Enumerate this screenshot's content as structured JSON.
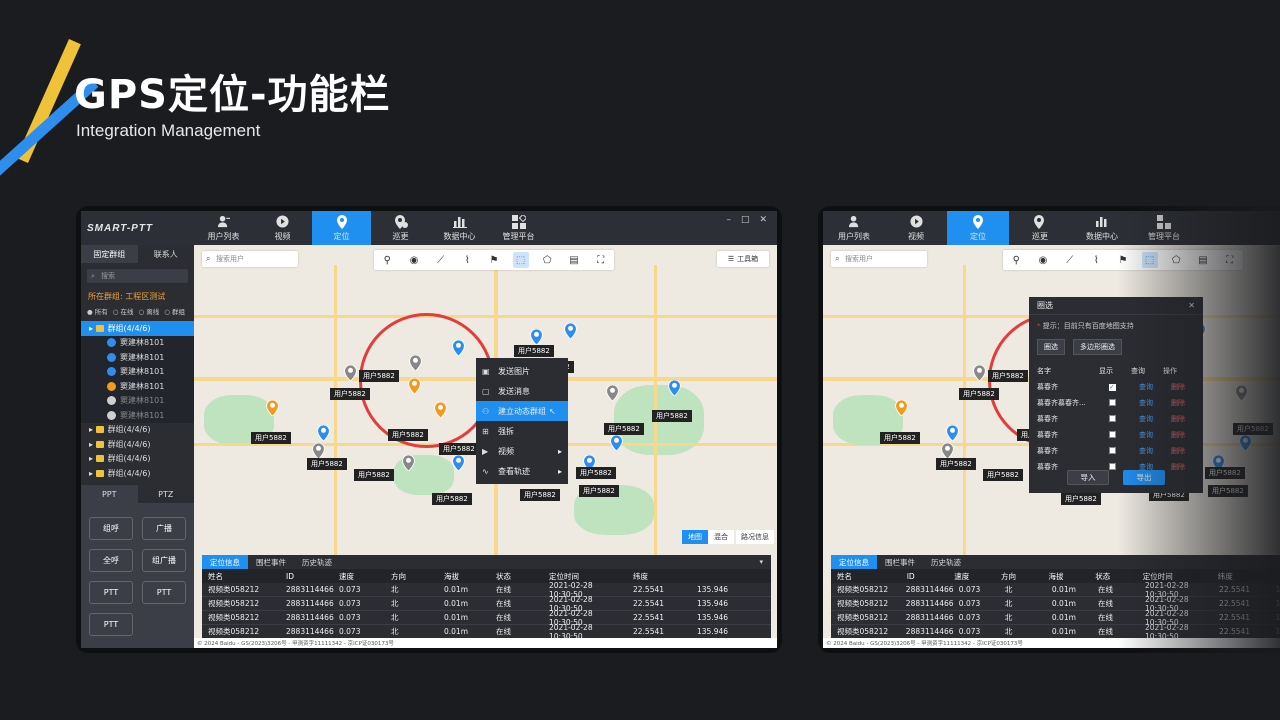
{
  "heading": {
    "title": "GPS定位-功能栏",
    "subtitle": "Integration Management"
  },
  "app": {
    "logo": "SMART-PTT",
    "win_min": "–",
    "win_max": "□",
    "win_close": "✕"
  },
  "nav": [
    {
      "label": "用户列表",
      "icon": "user-list-icon"
    },
    {
      "label": "视频",
      "icon": "play-icon"
    },
    {
      "label": "定位",
      "icon": "location-pin-icon",
      "active": true
    },
    {
      "label": "巡更",
      "icon": "patrol-icon"
    },
    {
      "label": "数据中心",
      "icon": "bar-chart-icon"
    },
    {
      "label": "管理平台",
      "icon": "grid-settings-icon"
    }
  ],
  "sidebar": {
    "tab_fixed": "固定群组",
    "tab_contacts": "联系人",
    "search_placeholder": "搜索",
    "current_group": "所在群组: 工程区测试",
    "filter_all": "所有",
    "filter_online": "在线",
    "filter_offline": "离线",
    "filter_group": "群组",
    "tree": [
      {
        "label": "群组(4/4/6)",
        "selected": true
      },
      {
        "label": "窦建林8101",
        "color": "#2d8ef0"
      },
      {
        "label": "窦建林8101",
        "color": "#2d8ef0"
      },
      {
        "label": "窦建林8101",
        "color": "#2d8ef0"
      },
      {
        "label": "窦建林8101",
        "color": "#f29a1f"
      },
      {
        "label": "窦建林8101",
        "color": "#cfcfcf",
        "offline": true
      },
      {
        "label": "窦建林8101",
        "color": "#cfcfcf",
        "offline": true
      }
    ],
    "groups": [
      "群组(4/4/6)",
      "群组(4/4/6)",
      "群组(4/4/6)",
      "群组(4/4/6)"
    ],
    "ptt_tab": "PPT",
    "ptz_tab": "PTZ",
    "buttons": [
      "组呼",
      "广播",
      "全呼",
      "组广播",
      "PTT",
      "PTT",
      "PTT"
    ]
  },
  "map": {
    "search_placeholder": "搜索用户",
    "toolbox": "工具箱",
    "marker_label": "用户5882",
    "map_btn": "地图",
    "hybrid_btn": "混合",
    "traffic_btn": "路况信息",
    "context_menu": [
      {
        "label": "发送图片"
      },
      {
        "label": "发送消息"
      },
      {
        "label": "建立动态群组",
        "highlight": true
      },
      {
        "label": "强拆"
      },
      {
        "label": "视频",
        "submenu": true
      },
      {
        "label": "查看轨迹",
        "submenu": true
      }
    ]
  },
  "panel": {
    "tabs": [
      "定位信息",
      "围栏事件",
      "历史轨迹"
    ],
    "columns": [
      "姓名",
      "ID",
      "速度",
      "方向",
      "海拔",
      "状态",
      "定位时间",
      "纬度",
      ""
    ],
    "rows": [
      [
        "视频类058212",
        "2883114466",
        "0.073",
        "北",
        "0.01m",
        "在线",
        "2021-02-28 10:30:50",
        "22.5541",
        "135.946"
      ],
      [
        "视频类058212",
        "2883114466",
        "0.073",
        "北",
        "0.01m",
        "在线",
        "2021-02-28 10:30:50",
        "22.5541",
        "135.946"
      ],
      [
        "视频类058212",
        "2883114466",
        "0.073",
        "北",
        "0.01m",
        "在线",
        "2021-02-28 10:30:50",
        "22.5541",
        "135.946"
      ],
      [
        "视频类058212",
        "2883114466",
        "0.073",
        "北",
        "0.01m",
        "在线",
        "2021-02-28 10:30:50",
        "22.5541",
        "135.946"
      ]
    ]
  },
  "footer": "© 2024 Baidu - GS(2023)3206号 - 甲测资字11111342 - 京ICP证030173号",
  "dialog": {
    "title": "圈选",
    "tip": "提示：目前只有百度地图支持",
    "btn_circle": "圈选",
    "btn_polygon": "多边形圈选",
    "col_name": "名字",
    "col_show": "显示",
    "col_query": "查询",
    "col_action": "操作",
    "rows": [
      {
        "name": "慕春齐",
        "checked": true
      },
      {
        "name": "慕春齐慕春齐...",
        "checked": false
      },
      {
        "name": "慕春齐",
        "checked": false
      },
      {
        "name": "慕春齐",
        "checked": false
      },
      {
        "name": "慕春齐",
        "checked": false
      },
      {
        "name": "慕春齐",
        "checked": false
      }
    ],
    "query": "查询",
    "delete": "删除",
    "import": "导入",
    "export": "导出"
  }
}
